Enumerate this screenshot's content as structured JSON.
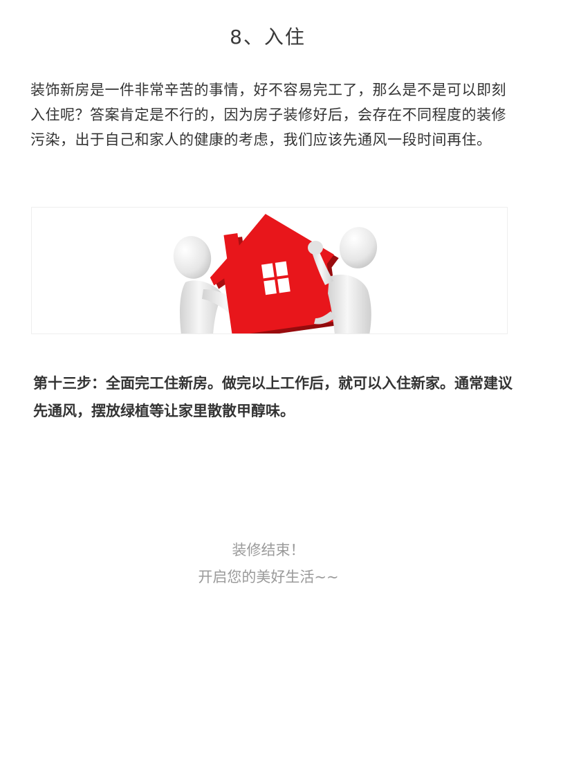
{
  "section": {
    "title": "8、入住"
  },
  "intro": {
    "paragraph": "装饰新房是一件非常辛苦的事情，好不容易完工了，那么是不是可以即刻入住呢？答案肯定是不行的，因为房子装修好后，会存在不同程度的装修污染，出于自己和家人的健康的考虑，我们应该先通风一段时间再住。"
  },
  "illustration": {
    "icon": "house-icon",
    "accent_color": "#e8161b"
  },
  "step": {
    "text": "第十三步：全面完工住新房。做完以上工作后，就可以入住新家。通常建议先通风，摆放绿植等让家里散散甲醇味。"
  },
  "closing": {
    "line1": "装修结束！",
    "line2": "开启您的美好生活~~"
  }
}
